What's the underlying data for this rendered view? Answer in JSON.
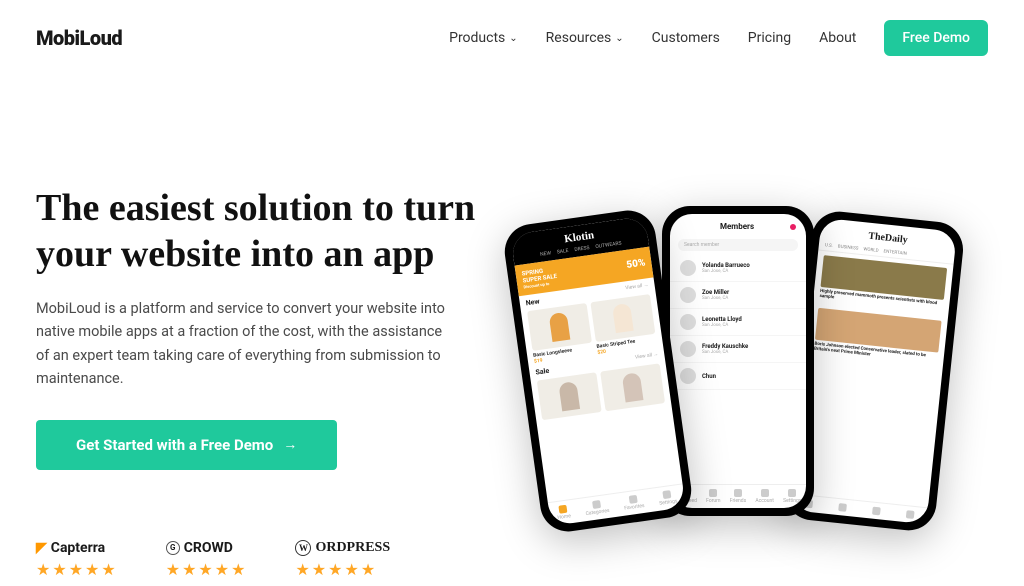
{
  "header": {
    "logo": "MobiLoud",
    "nav": {
      "products": "Products",
      "resources": "Resources",
      "customers": "Customers",
      "pricing": "Pricing",
      "about": "About",
      "demo": "Free Demo"
    }
  },
  "hero": {
    "title": "The easiest solution to turn your website into an app",
    "description": "MobiLoud is a platform and service to convert your website into native mobile apps at a fraction of the cost, with the assistance of an expert team taking care of everything from submission to maintenance.",
    "cta": "Get Started with a Free Demo"
  },
  "reviews": {
    "r1": {
      "name": "Capterra",
      "stars": "★★★★★"
    },
    "r2": {
      "name": "CROWD",
      "badge": "G",
      "stars": "★★★★★"
    },
    "r3": {
      "name": "ORDPRESS",
      "badge": "W",
      "stars": "★★★★★"
    }
  },
  "phones": {
    "p1": {
      "brand": "Klotin",
      "tabs": {
        "t1": "NEW",
        "t2": "SALE",
        "t3": "DRESS",
        "t4": "OUTWEARS"
      },
      "banner": {
        "line1": "SPRING",
        "line2": "SUPER SALE",
        "discount": "Discount up to",
        "pct": "50%"
      },
      "sec_new": "New",
      "viewall": "View all →",
      "item1": {
        "name": "Basic Longsleeve",
        "price": "$19"
      },
      "item2": {
        "name": "Basic Striped Tee",
        "price": "$20"
      },
      "sec_sale": "Sale",
      "nav": {
        "n1": "Home",
        "n2": "Categories",
        "n3": "Favorites",
        "n4": "Settings"
      }
    },
    "p2": {
      "title": "Members",
      "search": "Search member",
      "m1": {
        "name": "Yolanda Barrueco",
        "loc": "San Jose, CA"
      },
      "m2": {
        "name": "Zoe Miller",
        "loc": "San Jose, CA"
      },
      "m3": {
        "name": "Leonetta Lloyd",
        "loc": "San Jose, CA"
      },
      "m4": {
        "name": "Freddy Kauschke",
        "loc": "San Jose, CA"
      },
      "m5": {
        "name": "Chun",
        "loc": ""
      },
      "nav": {
        "n1": "Newsfeed",
        "n2": "Forum",
        "n3": "Friends",
        "n4": "Account",
        "n5": "Settings"
      }
    },
    "p3": {
      "brand": "TheDaily",
      "tabs": {
        "t1": "U.S.",
        "t2": "BUSINESS",
        "t3": "WORLD",
        "t4": "ENTERTAIN"
      },
      "a1": "Highly preserved mammoth presents scientists with blood sample",
      "a2": "Boris Johnson elected Conservative leader, slated to be Britain's next Prime Minister"
    }
  }
}
